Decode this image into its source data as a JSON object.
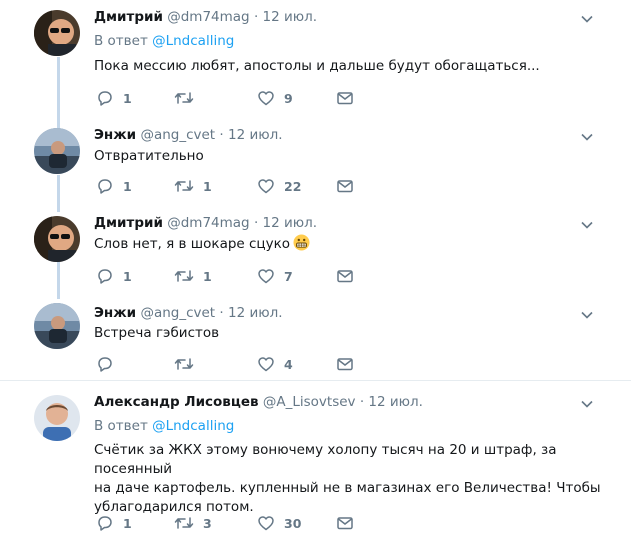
{
  "tweets": [
    {
      "name": "Дмитрий",
      "handle": "@dm74mag",
      "separator": "·",
      "date": "12 июл.",
      "reply_prefix": "В ответ",
      "reply_to": "@Lndcalling",
      "text": "Пока мессию любят, апостолы и дальше будут обогащаться...",
      "replies": "1",
      "retweets": "",
      "likes": "9"
    },
    {
      "name": "Энжи",
      "handle": "@ang_cvet",
      "separator": "·",
      "date": "12 июл.",
      "text": "Отвратительно",
      "replies": "1",
      "retweets": "1",
      "likes": "22"
    },
    {
      "name": "Дмитрий",
      "handle": "@dm74mag",
      "separator": "·",
      "date": "12 июл.",
      "text": "Слов нет, я в шокаре сцуко",
      "replies": "1",
      "retweets": "1",
      "likes": "7"
    },
    {
      "name": "Энжи",
      "handle": "@ang_cvet",
      "separator": "·",
      "date": "12 июл.",
      "text": "Встреча гэбистов",
      "replies": "",
      "retweets": "",
      "likes": "4"
    },
    {
      "name": "Александр Лисовцев",
      "handle": "@A_Lisovtsev",
      "separator": "·",
      "date": "12 июл.",
      "reply_prefix": "В ответ",
      "reply_to": "@Lndcalling",
      "text_line1": "Счётик за ЖКХ этому вонючему холопу тысяч на 20 и штраф, за посеянный",
      "text_line2": "на даче картофель. купленный не в магазинах его Величества! Чтобы",
      "text_line3": "ублагодарился потом.",
      "replies": "1",
      "retweets": "3",
      "likes": "30"
    }
  ],
  "colors": {
    "accent": "#1da1f2",
    "secondary_text": "#657786",
    "thread_line": "#c4d7ea",
    "divider": "#e6ecf0"
  },
  "icons": [
    "reply-icon",
    "retweet-icon",
    "like-icon",
    "direct-message-icon",
    "chevron-down-icon",
    "grimace-emoji-icon"
  ]
}
